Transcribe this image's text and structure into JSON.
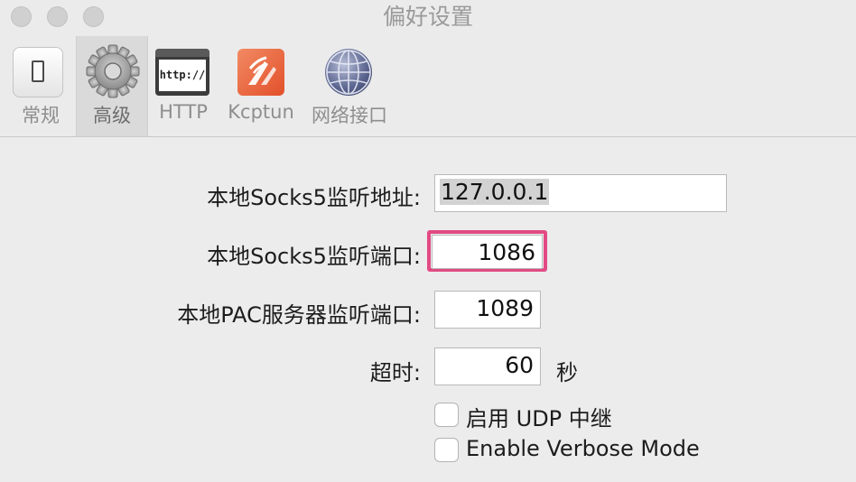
{
  "window": {
    "title": "偏好设置"
  },
  "toolbar": {
    "items": [
      {
        "label": "常规",
        "icon": "toggle-switch-icon"
      },
      {
        "label": "高级",
        "icon": "gear-icon",
        "selected": true
      },
      {
        "label": "HTTP",
        "icon": "http-browser-icon",
        "icon_text": "http://"
      },
      {
        "label": "Kcptun",
        "icon": "kcptun-logo-icon"
      },
      {
        "label": "网络接口",
        "icon": "network-globe-icon"
      }
    ]
  },
  "form": {
    "socks5_address": {
      "label": "本地Socks5监听地址:",
      "value": "127.0.0.1"
    },
    "socks5_port": {
      "label": "本地Socks5监听端口:",
      "value": "1086"
    },
    "pac_port": {
      "label": "本地PAC服务器监听端口:",
      "value": "1089"
    },
    "timeout": {
      "label": "超时:",
      "value": "60",
      "unit": "秒"
    },
    "udp_relay": {
      "label": "启用 UDP 中继",
      "checked": false
    },
    "verbose_mode": {
      "label": "Enable Verbose Mode",
      "checked": false
    }
  },
  "colors": {
    "focus_ring": "#e24a84",
    "text_selection": "#d2d2d2"
  }
}
